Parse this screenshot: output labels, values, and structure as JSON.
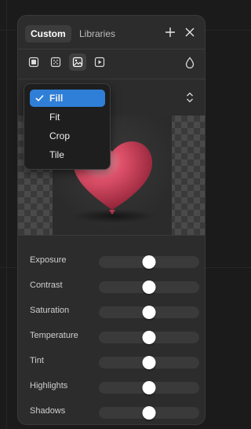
{
  "header": {
    "tabs": [
      {
        "label": "Custom",
        "active": true
      },
      {
        "label": "Libraries",
        "active": false
      }
    ],
    "add_icon": "plus-icon",
    "close_icon": "close-icon"
  },
  "toolbar": {
    "tools": [
      {
        "name": "solid-fill-icon",
        "active": false
      },
      {
        "name": "gradient-fill-icon",
        "active": false
      },
      {
        "name": "image-fill-icon",
        "active": true
      },
      {
        "name": "video-fill-icon",
        "active": false
      }
    ],
    "opacity_icon": "drop-icon"
  },
  "fill_mode": {
    "selected": "Fill",
    "options": [
      "Fill",
      "Fit",
      "Crop",
      "Tile"
    ],
    "toggle_icon": "chevron-up-down-icon"
  },
  "adjustments": [
    {
      "label": "Exposure",
      "value": 0.5
    },
    {
      "label": "Contrast",
      "value": 0.5
    },
    {
      "label": "Saturation",
      "value": 0.5
    },
    {
      "label": "Temperature",
      "value": 0.5
    },
    {
      "label": "Tint",
      "value": 0.5
    },
    {
      "label": "Highlights",
      "value": 0.5
    },
    {
      "label": "Shadows",
      "value": 0.5
    }
  ],
  "colors": {
    "accent": "#2f7fd8",
    "panel": "#2c2c2c",
    "heart": "#e0526b"
  }
}
